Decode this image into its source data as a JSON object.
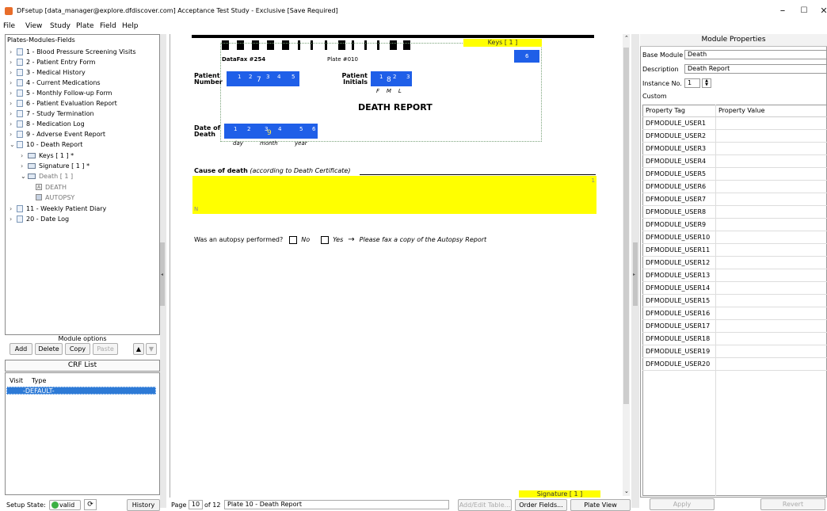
{
  "window": {
    "title": "DFsetup [data_manager@explore.dfdiscover.com] Acceptance Test Study - Exclusive [Save Required]",
    "min": "–",
    "max": "☐",
    "close": "✕"
  },
  "menu": [
    "File",
    "View",
    "Study",
    "Plate",
    "Field",
    "Help"
  ],
  "tree": {
    "header": "Plates-Modules-Fields",
    "plates": [
      "1 - Blood Pressure Screening Visits",
      "2 - Patient Entry Form",
      "3 - Medical History",
      "4 - Current Medications",
      "5 - Monthly Follow-up Form",
      "6 - Patient Evaluation Report",
      "7 - Study Termination",
      "8 - Medication Log",
      "9 - Adverse Event Report",
      "10 - Death Report"
    ],
    "modules": [
      "Keys [ 1 ] *",
      "Signature [ 1 ] *",
      "Death [ 1 ]"
    ],
    "fields": [
      "DEATH",
      "AUTOPSY"
    ],
    "after": [
      "11 - Weekly Patient Diary",
      "20 - Date Log"
    ]
  },
  "module_options": {
    "label": "Module options",
    "add": "Add",
    "delete": "Delete",
    "copy": "Copy",
    "paste": "Paste"
  },
  "crf": {
    "title": "CRF List",
    "col_visit": "Visit",
    "col_type": "Type",
    "row": "-DEFAULT-"
  },
  "status": {
    "label": "Setup State:",
    "state": "valid",
    "history": "History",
    "page": "Page",
    "page_num": "10",
    "of": "of 12",
    "plate_name": "Plate 10 - Death Report",
    "add_edit": "Add/Edit Table...",
    "order": "Order Fields...",
    "plate_view": "Plate View"
  },
  "form": {
    "keys_label": "Keys [ 1 ]",
    "datafax": "DataFax #254",
    "plate": "Plate #010",
    "box6": "6",
    "pn_label1": "Patient",
    "pn_label2": "Number",
    "pi_label1": "Patient",
    "pi_label2": "Initials",
    "fml": "F    M    L",
    "title": "DEATH REPORT",
    "dod1": "Date of",
    "dod2": "Death",
    "day": "day",
    "month": "month",
    "year": "year",
    "cause": "Cause of death",
    "cause_note": "(according to Death Certificate)",
    "autopsy_q": "Was an autopsy performed?",
    "no": "No",
    "yes": "Yes",
    "arrow": "→",
    "fax_note": "Please fax a copy of the Autopsy Report",
    "sig_label": "Signature [ 1 ]",
    "digits_pn": [
      "1",
      "2",
      "7",
      "3",
      "4",
      "5"
    ],
    "digits_pi": [
      "1",
      "8",
      "2",
      "3"
    ],
    "digits_dd": [
      "1",
      "2",
      "3",
      "9",
      "4",
      "5",
      "6"
    ],
    "cause_num1": "1",
    "cause_num2": "N"
  },
  "props": {
    "title": "Module Properties",
    "base_label": "Base Module",
    "base_val": "Death",
    "desc_label": "Description",
    "desc_val": "Death Report",
    "inst_label": "Instance No.",
    "inst_val": "1",
    "custom": "Custom",
    "col_tag": "Property Tag",
    "col_val": "Property Value",
    "tags": [
      "DFMODULE_USER1",
      "DFMODULE_USER2",
      "DFMODULE_USER3",
      "DFMODULE_USER4",
      "DFMODULE_USER5",
      "DFMODULE_USER6",
      "DFMODULE_USER7",
      "DFMODULE_USER8",
      "DFMODULE_USER9",
      "DFMODULE_USER10",
      "DFMODULE_USER11",
      "DFMODULE_USER12",
      "DFMODULE_USER13",
      "DFMODULE_USER14",
      "DFMODULE_USER15",
      "DFMODULE_USER16",
      "DFMODULE_USER17",
      "DFMODULE_USER18",
      "DFMODULE_USER19",
      "DFMODULE_USER20"
    ],
    "apply": "Apply",
    "revert": "Revert"
  },
  "colors": {
    "field_blue": "#1f5fe8",
    "highlight_yellow": "#ffff00",
    "selection": "#2d7ad6",
    "valid_green": "#3cb043"
  }
}
